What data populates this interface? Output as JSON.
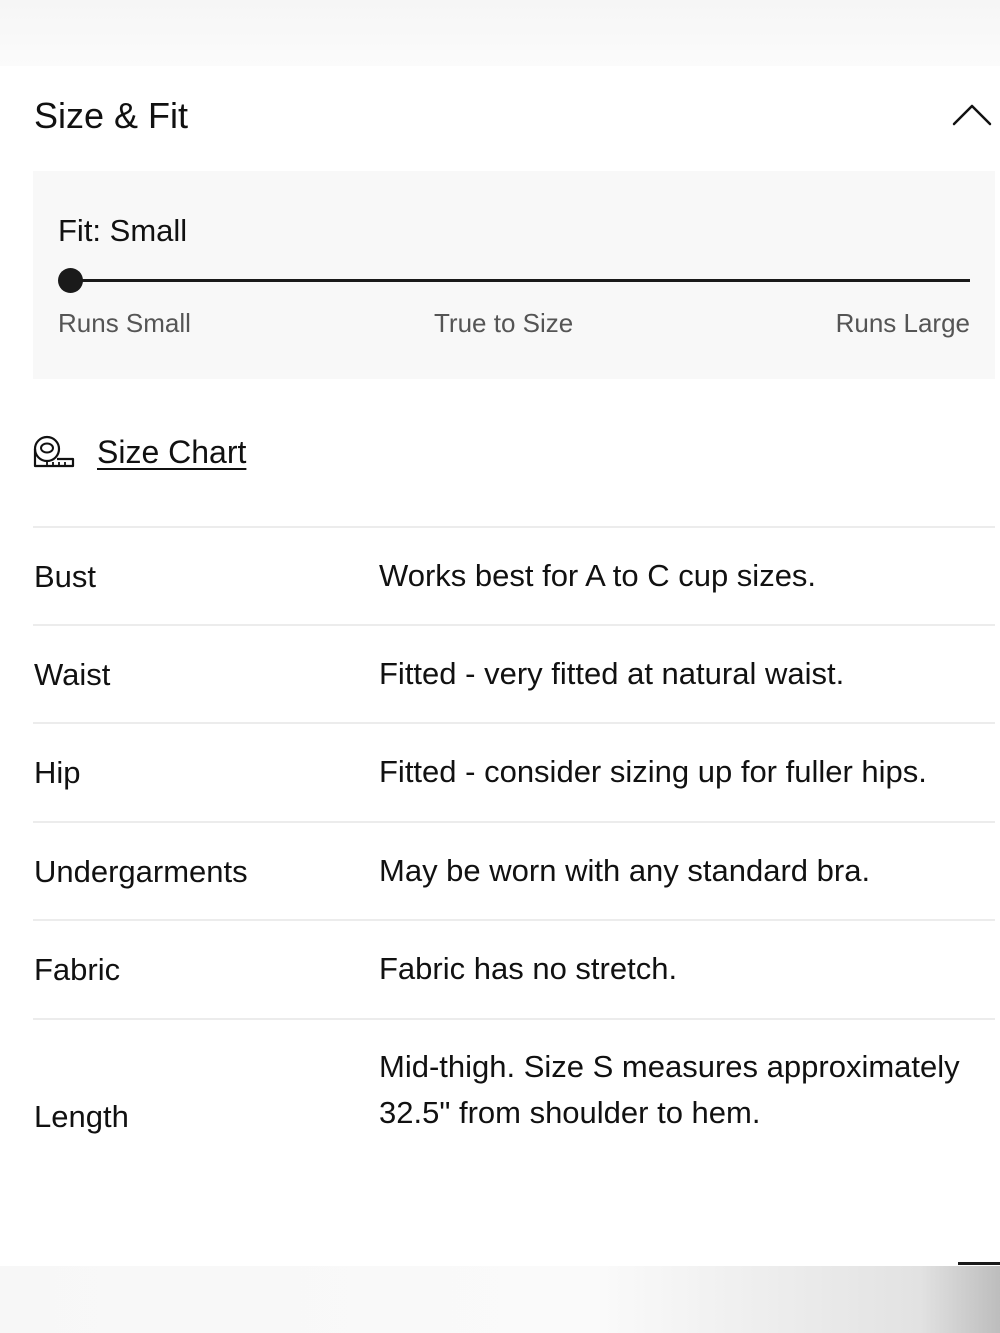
{
  "section": {
    "title": "Size & Fit"
  },
  "fit": {
    "label": "Fit: Small",
    "scale": {
      "left": "Runs Small",
      "middle": "True to Size",
      "right": "Runs Large"
    },
    "selected_position": 0
  },
  "size_chart": {
    "icon": "measuring-tape-icon",
    "label": "Size Chart"
  },
  "rows": [
    {
      "label": "Bust",
      "value": "Works best for A to C cup sizes."
    },
    {
      "label": "Waist",
      "value": "Fitted - very fitted at natural waist."
    },
    {
      "label": "Hip",
      "value": "Fitted - consider sizing up for fuller hips."
    },
    {
      "label": "Undergarments",
      "value": "May be worn with any standard bra."
    },
    {
      "label": "Fabric",
      "value": "Fabric has no stretch."
    },
    {
      "label": "Length",
      "value": "Mid-thigh. Size S measures approximately 32.5\" from shoulder to hem."
    }
  ]
}
